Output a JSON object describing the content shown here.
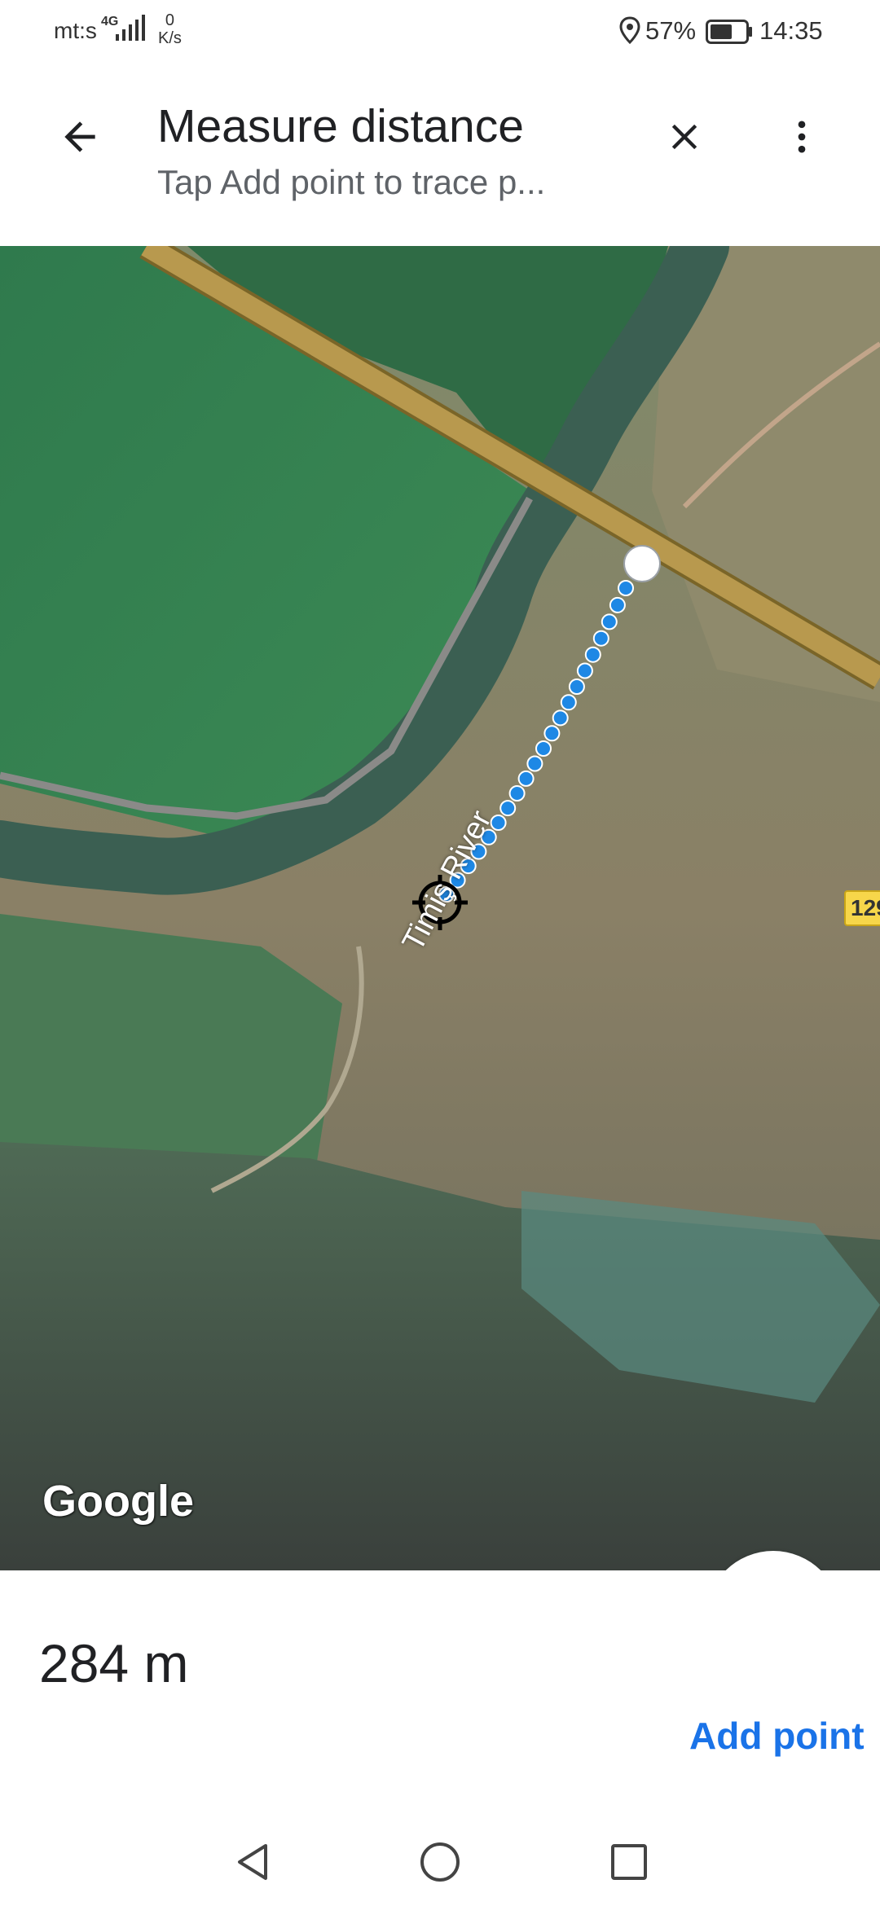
{
  "status_bar": {
    "carrier": "mt:s",
    "network": "4G",
    "speed_value": "0",
    "speed_unit": "K/s",
    "battery_pct": "57%",
    "time": "14:35"
  },
  "header": {
    "title": "Measure distance",
    "subtitle": "Tap Add point to trace p...",
    "back_icon": "arrow-left-icon",
    "close_icon": "close-icon",
    "more_icon": "more-vert-icon"
  },
  "map": {
    "river_label": "Timiş River",
    "road_shield": "129",
    "logo": "Google",
    "locate_icon": "my-location-icon",
    "add_icon": "plus-icon",
    "path_color": "#1e88e5",
    "fab_color": "#3b78e7"
  },
  "bottom": {
    "distance": "284 m",
    "add_point_label": "Add point"
  },
  "nav": {
    "back_icon": "nav-back-icon",
    "home_icon": "nav-home-icon",
    "recent_icon": "nav-recent-icon"
  }
}
